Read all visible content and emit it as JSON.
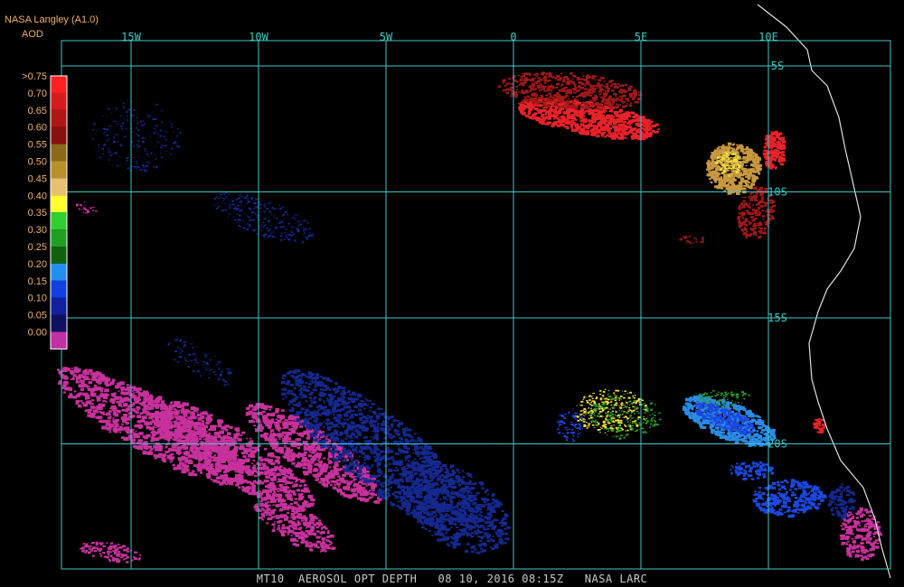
{
  "header": {
    "title": "NASA Langley (A1.0)",
    "subtitle": "AOD"
  },
  "footer": {
    "text": "MT10  AEROSOL OPT DEPTH   08 10, 2016 08:15Z   NASA LARC"
  },
  "grid": {
    "color": "#40c8c8",
    "longitudes": [
      {
        "label": "15W",
        "value": -15
      },
      {
        "label": "10W",
        "value": -10
      },
      {
        "label": "5W",
        "value": -5
      },
      {
        "label": "0",
        "value": 0
      },
      {
        "label": "5E",
        "value": 5
      },
      {
        "label": "10E",
        "value": 10
      }
    ],
    "latitudes": [
      {
        "label": "5S",
        "value": -5
      },
      {
        "label": "10S",
        "value": -10
      },
      {
        "label": "15S",
        "value": -15
      },
      {
        "label": "20S",
        "value": -20
      }
    ]
  },
  "legend": {
    "labels": [
      ">0.75",
      "0.70",
      "0.65",
      "0.60",
      "0.55",
      "0.50",
      "0.45",
      "0.40",
      "0.35",
      "0.30",
      "0.25",
      "0.20",
      "0.15",
      "0.10",
      "0.05",
      "0.00"
    ],
    "colors": [
      "#ff2020",
      "#d41c1c",
      "#b01616",
      "#8a1010",
      "#8a6a1a",
      "#b8902a",
      "#e8c070",
      "#ffff30",
      "#30d030",
      "#20a020",
      "#106010",
      "#2090f0",
      "#1040e0",
      "#1020a0",
      "#101060",
      "#c030a0"
    ]
  },
  "palette": {
    "magenta": "#c8309c",
    "navy": "#142890",
    "blue": "#1a48e0",
    "lightblue": "#2a8ce8",
    "red": "#e8222a",
    "darkred": "#a01818",
    "tan": "#c89840",
    "yellow": "#f0e040",
    "green": "#28a028",
    "coast": "#e0e0e0"
  }
}
